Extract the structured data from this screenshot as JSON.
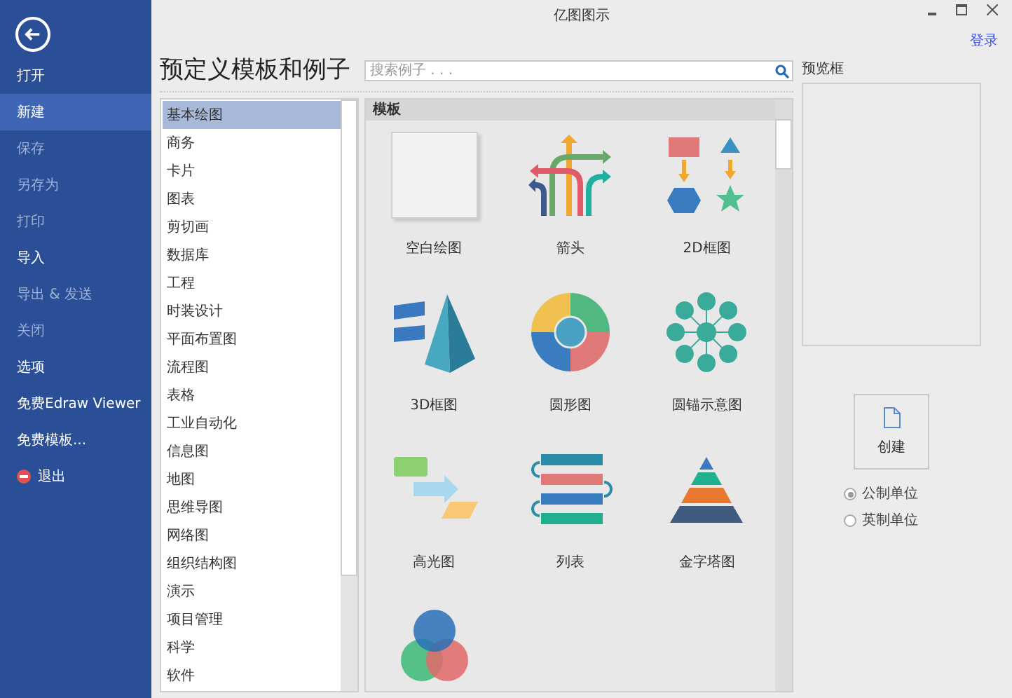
{
  "window": {
    "title": "亿图图示",
    "login": "登录"
  },
  "sidebar": {
    "items": [
      {
        "label": "打开",
        "selected": false,
        "disabled": false
      },
      {
        "label": "新建",
        "selected": true,
        "disabled": false
      },
      {
        "label": "保存",
        "selected": false,
        "disabled": true
      },
      {
        "label": "另存为",
        "selected": false,
        "disabled": true
      },
      {
        "label": "打印",
        "selected": false,
        "disabled": true
      },
      {
        "label": "导入",
        "selected": false,
        "disabled": false
      },
      {
        "label": "导出 & 发送",
        "selected": false,
        "disabled": true
      },
      {
        "label": "关闭",
        "selected": false,
        "disabled": true
      },
      {
        "label": "选项",
        "selected": false,
        "disabled": false
      },
      {
        "label": "免费Edraw Viewer",
        "selected": false,
        "disabled": false
      },
      {
        "label": "免费模板...",
        "selected": false,
        "disabled": false
      },
      {
        "label": "退出",
        "selected": false,
        "disabled": false,
        "kind": "exit"
      }
    ]
  },
  "heading": "预定义模板和例子",
  "search": {
    "placeholder": "搜索例子 . . ."
  },
  "categories": [
    {
      "label": "基本绘图",
      "selected": true
    },
    {
      "label": "商务",
      "selected": false
    },
    {
      "label": "卡片",
      "selected": false
    },
    {
      "label": "图表",
      "selected": false
    },
    {
      "label": "剪切画",
      "selected": false
    },
    {
      "label": "数据库",
      "selected": false
    },
    {
      "label": "工程",
      "selected": false
    },
    {
      "label": "时装设计",
      "selected": false
    },
    {
      "label": "平面布置图",
      "selected": false
    },
    {
      "label": "流程图",
      "selected": false
    },
    {
      "label": "表格",
      "selected": false
    },
    {
      "label": "工业自动化",
      "selected": false
    },
    {
      "label": "信息图",
      "selected": false
    },
    {
      "label": "地图",
      "selected": false
    },
    {
      "label": "思维导图",
      "selected": false
    },
    {
      "label": "网络图",
      "selected": false
    },
    {
      "label": "组织结构图",
      "selected": false
    },
    {
      "label": "演示",
      "selected": false
    },
    {
      "label": "项目管理",
      "selected": false
    },
    {
      "label": "科学",
      "selected": false
    },
    {
      "label": "软件",
      "selected": false
    }
  ],
  "templates": {
    "header": "模板",
    "items": [
      {
        "kind": "blank",
        "label": "空白绘图"
      },
      {
        "kind": "arrows",
        "label": "箭头"
      },
      {
        "kind": "block2d",
        "label": "2D框图"
      },
      {
        "kind": "block3d",
        "label": "3D框图"
      },
      {
        "kind": "circle",
        "label": "圆形图"
      },
      {
        "kind": "radial",
        "label": "圆锚示意图"
      },
      {
        "kind": "highlight",
        "label": "高光图"
      },
      {
        "kind": "list",
        "label": "列表"
      },
      {
        "kind": "pyramid",
        "label": "金字塔图"
      },
      {
        "kind": "venn"
      }
    ]
  },
  "preview": {
    "label": "预览框"
  },
  "create_button": "创建",
  "units": [
    {
      "label": "公制单位",
      "selected": true
    },
    {
      "label": "英制单位",
      "selected": false
    }
  ]
}
